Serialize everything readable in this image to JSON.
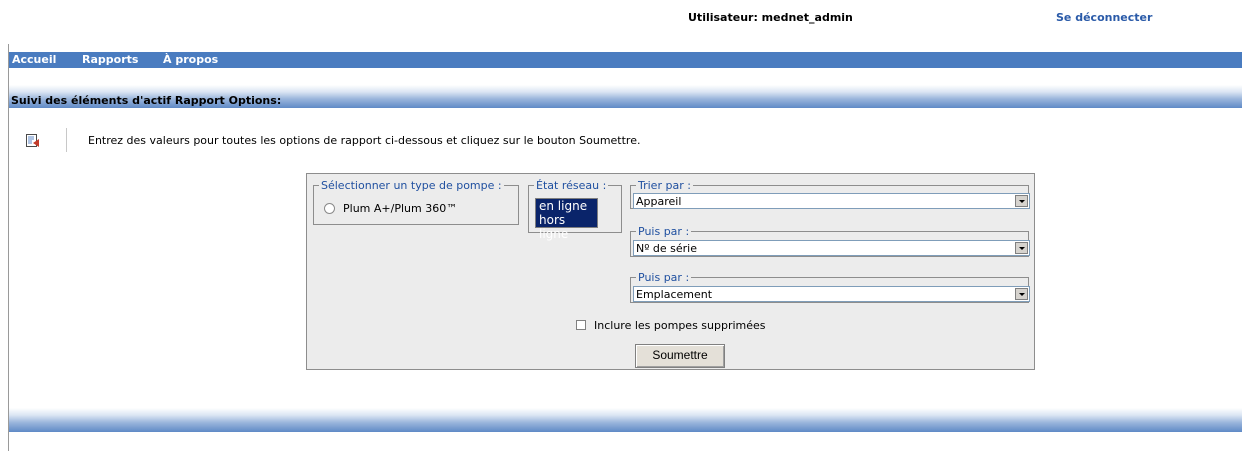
{
  "header": {
    "user_text": "Utilisateur: mednet_admin",
    "logout_label": "Se déconnecter"
  },
  "nav": {
    "items": [
      {
        "label": "Accueil"
      },
      {
        "label": "Rapports"
      },
      {
        "label": "À propos"
      }
    ]
  },
  "section": {
    "title": "Suivi des éléments d'actif Rapport Options:"
  },
  "hint": {
    "icon": "report-options-icon",
    "text": "Entrez des valeurs pour toutes les options de rapport ci-dessous et cliquez sur le bouton Soumettre."
  },
  "form": {
    "pump_type": {
      "legend": "Sélectionner un type de pompe :",
      "option_label": "Plum A+/Plum 360™"
    },
    "network": {
      "legend": "État réseau :",
      "options": [
        "en ligne",
        "hors ligne"
      ]
    },
    "sort1": {
      "legend": "Trier par :",
      "value": "Appareil"
    },
    "sort2": {
      "legend": "Puis par :",
      "value": "Nº de série"
    },
    "sort3": {
      "legend": "Puis par :",
      "value": "Emplacement"
    },
    "include_deleted_label": "Inclure les pompes supprimées",
    "submit_label": "Soumettre"
  }
}
